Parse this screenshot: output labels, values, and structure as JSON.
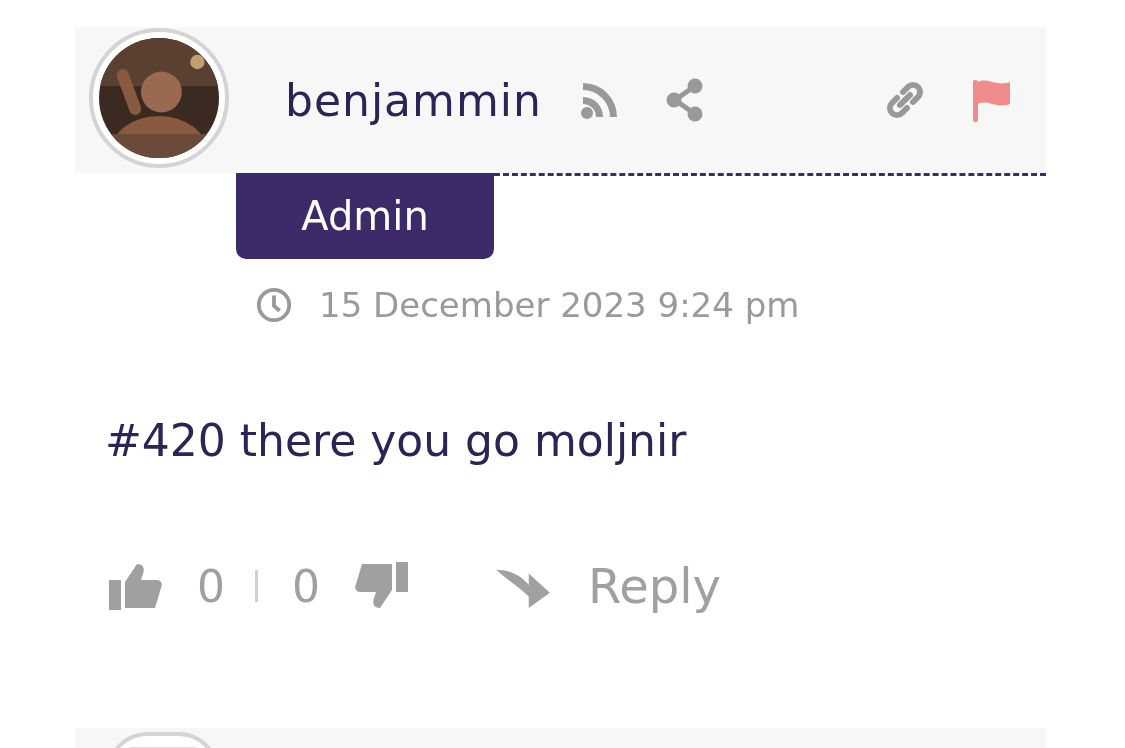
{
  "comment": {
    "author": "benjammin",
    "role_badge": "Admin",
    "timestamp": "15 December 2023 9:24 pm",
    "text": "#420 there you go moljnir",
    "upvotes": "0",
    "downvotes": "0",
    "reply_label": "Reply"
  }
}
